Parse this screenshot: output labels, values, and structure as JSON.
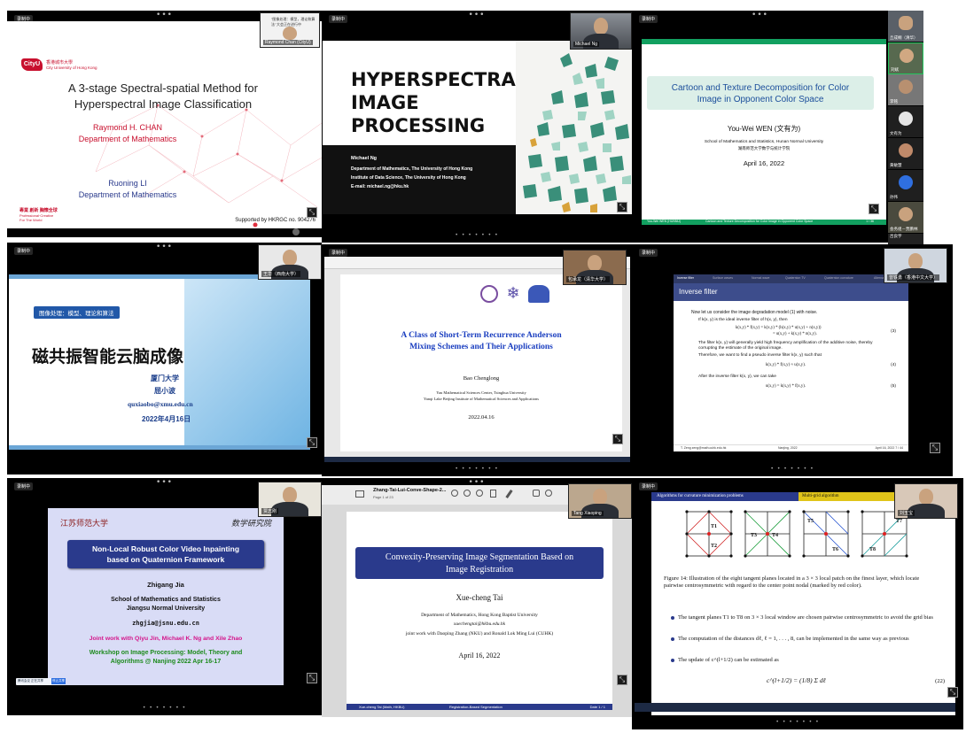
{
  "common": {
    "record_label": "录制中",
    "more": "•••",
    "page_dots": "• • • • • • •",
    "fullscreen": "⤡"
  },
  "t1": {
    "logo": "CityU",
    "university_cn": "香港城市大學",
    "university_en": "City University of Hong Kong",
    "title_l1": "A 3-stage Spectral-spatial Method for",
    "title_l2": "Hyperspectral Image Classification",
    "author1": "Raymond H. CHAN",
    "dept1": "Department of Mathematics",
    "author2": "Ruoning LI",
    "dept2": "Department of Mathematics",
    "motto_cn": "專業 創新 胸懷全球",
    "motto_en1": "Professional·Creative",
    "motto_en2": "For The World",
    "support": "Supported by HKRGC no. 904276",
    "cam_name": "Raymond Chan (CityU)",
    "cam_caption1": "\"图像处理：模型，理论和算法\"",
    "cam_caption2": "大会正在进行中"
  },
  "t2": {
    "title_l1": "HYPERSPECTRAL",
    "title_l2": "IMAGE",
    "title_l3": "PROCESSING",
    "name": "Michael Ng",
    "line1": "Department of Mathematics, The University of Hong Kong",
    "line2": "Institute of Data Science, The University of Hong Kong",
    "line3": "E-mail: michael.ng@hku.hk",
    "cam_name": "Michael Ng"
  },
  "t3": {
    "title_l1": "Cartoon and Texture Decomposition for Color",
    "title_l2": "Image in Opponent Color Space",
    "author": "You-Wei WEN (文有为)",
    "school": "School of Mathematics and Statistics, Hunan Normal University",
    "school_cn": "湖南师范大学数学与统计学院",
    "date": "April 16, 2022",
    "footer_left": "You-Wei WEN (HUNNU)",
    "footer_mid": "Cartoon and Texture Decomposition for Color Image in Opponent Color Space",
    "footer_right": "1 / 36"
  },
  "participants": [
    {
      "name": "丘成桐（清华）"
    },
    {
      "name": "刘斌"
    },
    {
      "name": "李铭"
    },
    {
      "name": "文有为"
    },
    {
      "name": "黄敏慧"
    },
    {
      "name": "孙伟"
    },
    {
      "name": "吕良宇"
    },
    {
      "name": "会务组－贾鹏林"
    }
  ],
  "t4": {
    "tag": "图像处理：模型、理论和算法",
    "title": "磁共振智能云脑成像",
    "univ": "厦门大学",
    "name": "屈小波",
    "email": "quxiaobo@xmu.edu.cn",
    "date": "2022年4月16日",
    "cam_name": "王华（西南大学）"
  },
  "t5": {
    "title_l1": "A Class of Short-Term Recurrence Anderson",
    "title_l2": "Mixing Schemes and Their Applications",
    "author": "Bao Chenglong",
    "aff1": "Yau Mathematical Sciences Center, Tsinghua University",
    "aff2": "Yanqi Lake Beijing Institute of Mathematical Sciences and Applications",
    "date": "2022.04.16",
    "cam_name": "包承龙（清华大学）"
  },
  "t6": {
    "nav": [
      "Inverse filter",
      "Surface waves",
      "Normal wave",
      "Quaternion TV",
      "Quaternion curvature",
      "Alternating"
    ],
    "heading": "Inverse filter",
    "intro": "Now let us consider the image degradation model (1) with noise.",
    "b1": "If k(x, y) is the ideal inverse filter of h(x, y), then",
    "eq3a": "k(x,y) * f(x,y)  =  k(x,y) * (h(x,y) * u(x,y) + n(x,y))",
    "eq3b": "=  u(x,y) + k(x,y) * n(x,y).",
    "eq3n": "(3)",
    "b2": "The filter k(x, y) will generally yield high frequency amplification of the additive noise, thereby corrupting the estimate of the original image.",
    "b3": "Therefore, we want to find a pseudo inverse filter k(x, y) such that",
    "eq4": "k(x,y) * f(x,y) ≈ u(x,y).",
    "eq4n": "(4)",
    "b4": "After the inverse filter k(x, y), we can take",
    "eq5": "u(x,y) = k(x,y) * f(x,y).",
    "eq5n": "(5)",
    "footer_left": "T. Zeng  zeng@math.cuhk.edu.hk",
    "footer_mid": "Nanjing, 2022",
    "footer_right": "April 16, 2022     7 / 44",
    "cam_name": "曾铁勇（香港中文大学）"
  },
  "t7": {
    "logo_left": "江苏师范大学",
    "logo_right": "数学研究院",
    "title_l1": "Non-Local Robust Color Video Inpainting",
    "title_l2": "based on Quaternion Framework",
    "author": "Zhigang Jia",
    "school1": "School of Mathematics and Statistics",
    "school2": "Jiangsu Normal University",
    "email": "zhgjia@jsnu.edu.cn",
    "joint": "Joint work with Qiyu Jin, Michael K. Ng and Xile Zhao",
    "workshop1": "Workshop on Image Processing: Model, Theory and",
    "workshop2": "Algorithms @ Nanjing 2022 Apr 16-17",
    "cam_name": "贾志刚",
    "taskbar_item1": "腾讯会议 正在共享",
    "taskbar_item2": "停止共享"
  },
  "t8": {
    "file_name": "Zhang-Tai-Lui-Conve-Shape-2...",
    "page_info": "Page 1 of 23",
    "title_l1": "Convexity-Preserving Image Segmentation Based on",
    "title_l2": "Image Registration",
    "author": "Xue-cheng Tai",
    "dept": "Department of Mathematics, Hong Kong Baptist University",
    "email": "xuechengtai@hkbu.edu.hk",
    "joint": "joint work with Daoping Zhang (NKU) and Ronald Lok Ming Lui (CUHK)",
    "date": "April 16, 2022",
    "footer_left": "Xue-cheng Tai (Math, HKBU)",
    "footer_mid": "Registration-Based Segmentation",
    "footer_right": "Date   1 / 1",
    "cam_name": "Tang Xiaoping"
  },
  "t9": {
    "header_left": "Algorithms for curvature minimization problems",
    "header_right": "Multi-grid algorithm",
    "labels": [
      "T1",
      "T2",
      "T3",
      "T4",
      "T5",
      "T6",
      "T7",
      "T8"
    ],
    "caption": "Figure 14: Illustration of the eight tangent planes located in a 3 × 3 local patch on the finest layer, which locate pairwise centrosymmetric with regard to the center point nodal (marked by red color).",
    "bullet1": "The tangent planes T1 to T8 on 3 × 3 local window are chosen pairwise centrosymmetric to avoid the grid bias",
    "bullet2": "The computation of the distances dℓ, ℓ = 1, . . . , 8, can be implemented in the same way as previous",
    "bullet3": "The update of c^(l+1/2) can be estimated as",
    "formula": "c^(l+1/2) = (1/8) Σ dℓ",
    "formula_no": "(22)",
    "cam_name": "刘玉宝"
  },
  "colors": {
    "cityu_red": "#c8102e",
    "beamer_blue": "#2a3a8c",
    "cartoon_bg": "#dcefe8",
    "slide_green": "#12a060"
  }
}
